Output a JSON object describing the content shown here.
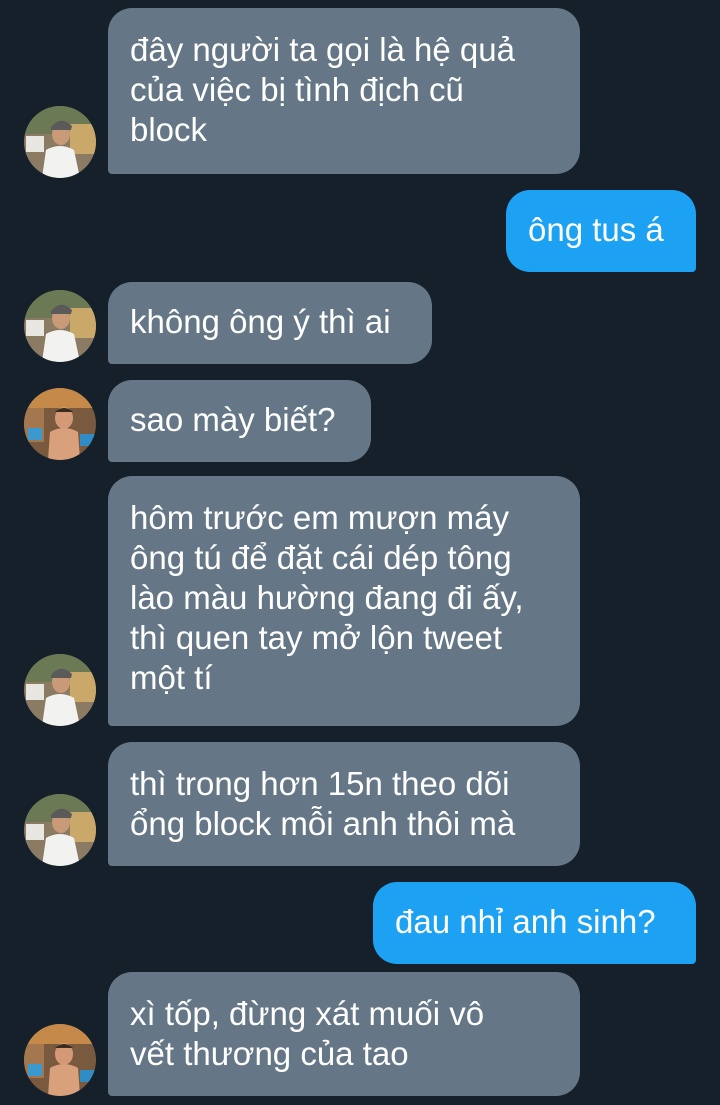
{
  "colors": {
    "background": "#15202b",
    "received_bubble": "#657786",
    "sent_bubble": "#1da1f2",
    "text": "#ffffff"
  },
  "messages": [
    {
      "direction": "received",
      "avatar": "avatar-man-white-shirt",
      "text": "đây người ta gọi là hệ quả\ncủa việc bị tình địch cũ\nblock"
    },
    {
      "direction": "sent",
      "text": "ông tus á"
    },
    {
      "direction": "received",
      "avatar": "avatar-man-white-shirt",
      "text": "không ông ý thì ai"
    },
    {
      "direction": "received",
      "avatar": "avatar-shirtless-man",
      "text": "sao mày biết?"
    },
    {
      "direction": "received",
      "avatar": "avatar-man-white-shirt",
      "text": "hôm trước em mượn máy\nông tú để đặt cái dép tông\nlào màu hường đang đi ấy,\nthì quen tay mở lộn tweet\nmột tí"
    },
    {
      "direction": "received",
      "avatar": "avatar-man-white-shirt",
      "text": "thì trong hơn 15n theo dõi\nổng block mỗi anh thôi mà"
    },
    {
      "direction": "sent",
      "text": "đau nhỉ anh sinh?"
    },
    {
      "direction": "received",
      "avatar": "avatar-shirtless-man",
      "text": "xì tốp, đừng xát muối vô\nvết thương của tao"
    }
  ]
}
